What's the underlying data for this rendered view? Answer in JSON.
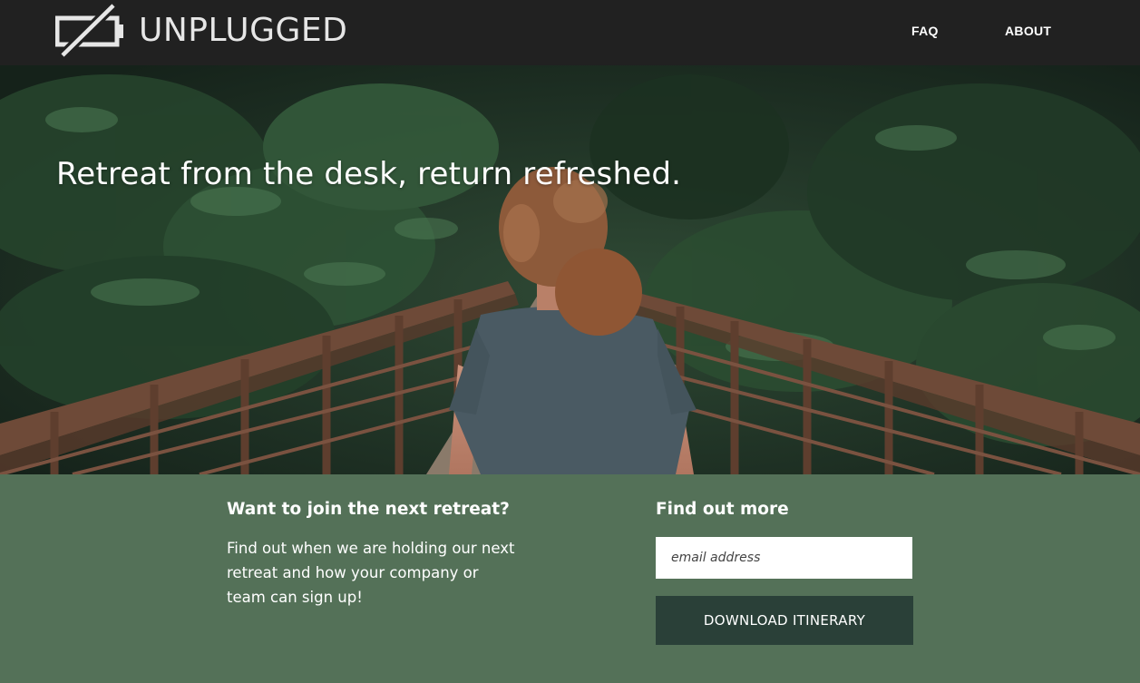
{
  "brand": {
    "name": "UNPLUGGED",
    "logo_icon": "unplugged-battery-icon"
  },
  "nav": {
    "faq": "FAQ",
    "about": "ABOUT"
  },
  "hero": {
    "title": "Retreat from the desk, return refreshed."
  },
  "join": {
    "heading": "Want to join the next retreat?",
    "text": "Find out when we are holding our next retreat and how your company or team can sign up!"
  },
  "more": {
    "heading": "Find out more",
    "email_placeholder": "email address",
    "button_label": "DOWNLOAD ITINERARY"
  },
  "colors": {
    "header_bg": "#212121",
    "footer_bg": "#547158",
    "button_bg": "#2a4038"
  }
}
